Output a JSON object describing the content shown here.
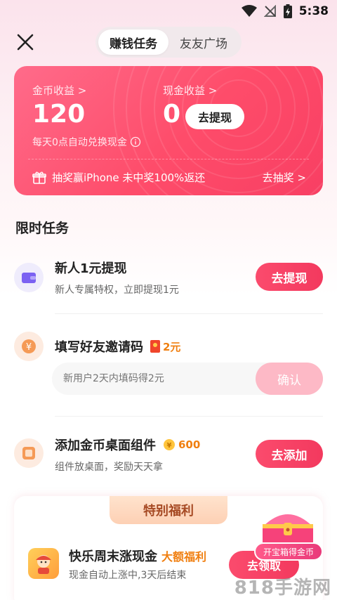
{
  "status_bar": {
    "time": "5:38"
  },
  "header": {
    "tabs": [
      "赚钱任务",
      "友友广场"
    ]
  },
  "earnings": {
    "coin_label": "金币收益 >",
    "coin_value": "120",
    "cash_label": "现金收益 >",
    "cash_value": "0",
    "withdraw_label": "去提现",
    "note": "每天0点自动兑换现金",
    "lottery_text": "抽奖赢iPhone 未中奖100%返还",
    "lottery_link": "去抽奖 >"
  },
  "section_title": "限时任务",
  "tasks": [
    {
      "title": "新人1元提现",
      "subtitle": "新人专属特权，立即提现1元",
      "button": "去提现"
    },
    {
      "title": "填写好友邀请码",
      "reward": "2元",
      "input_placeholder": "新用户2天内填码得2元",
      "button": "确认"
    },
    {
      "title": "添加金币桌面组件",
      "reward": "600",
      "subtitle": "组件放桌面，奖励天天拿",
      "button": "去添加"
    }
  ],
  "special": {
    "banner": "特别福利",
    "title": "快乐周末涨现金",
    "tag": "大额福利",
    "subtitle": "现金自动上涨中,3天后结束",
    "button": "去领取",
    "chest_badge": "开宝箱得金币"
  },
  "watermark": "818手游网",
  "colors": {
    "accent": "#f83f63",
    "reward": "#f07f10"
  }
}
